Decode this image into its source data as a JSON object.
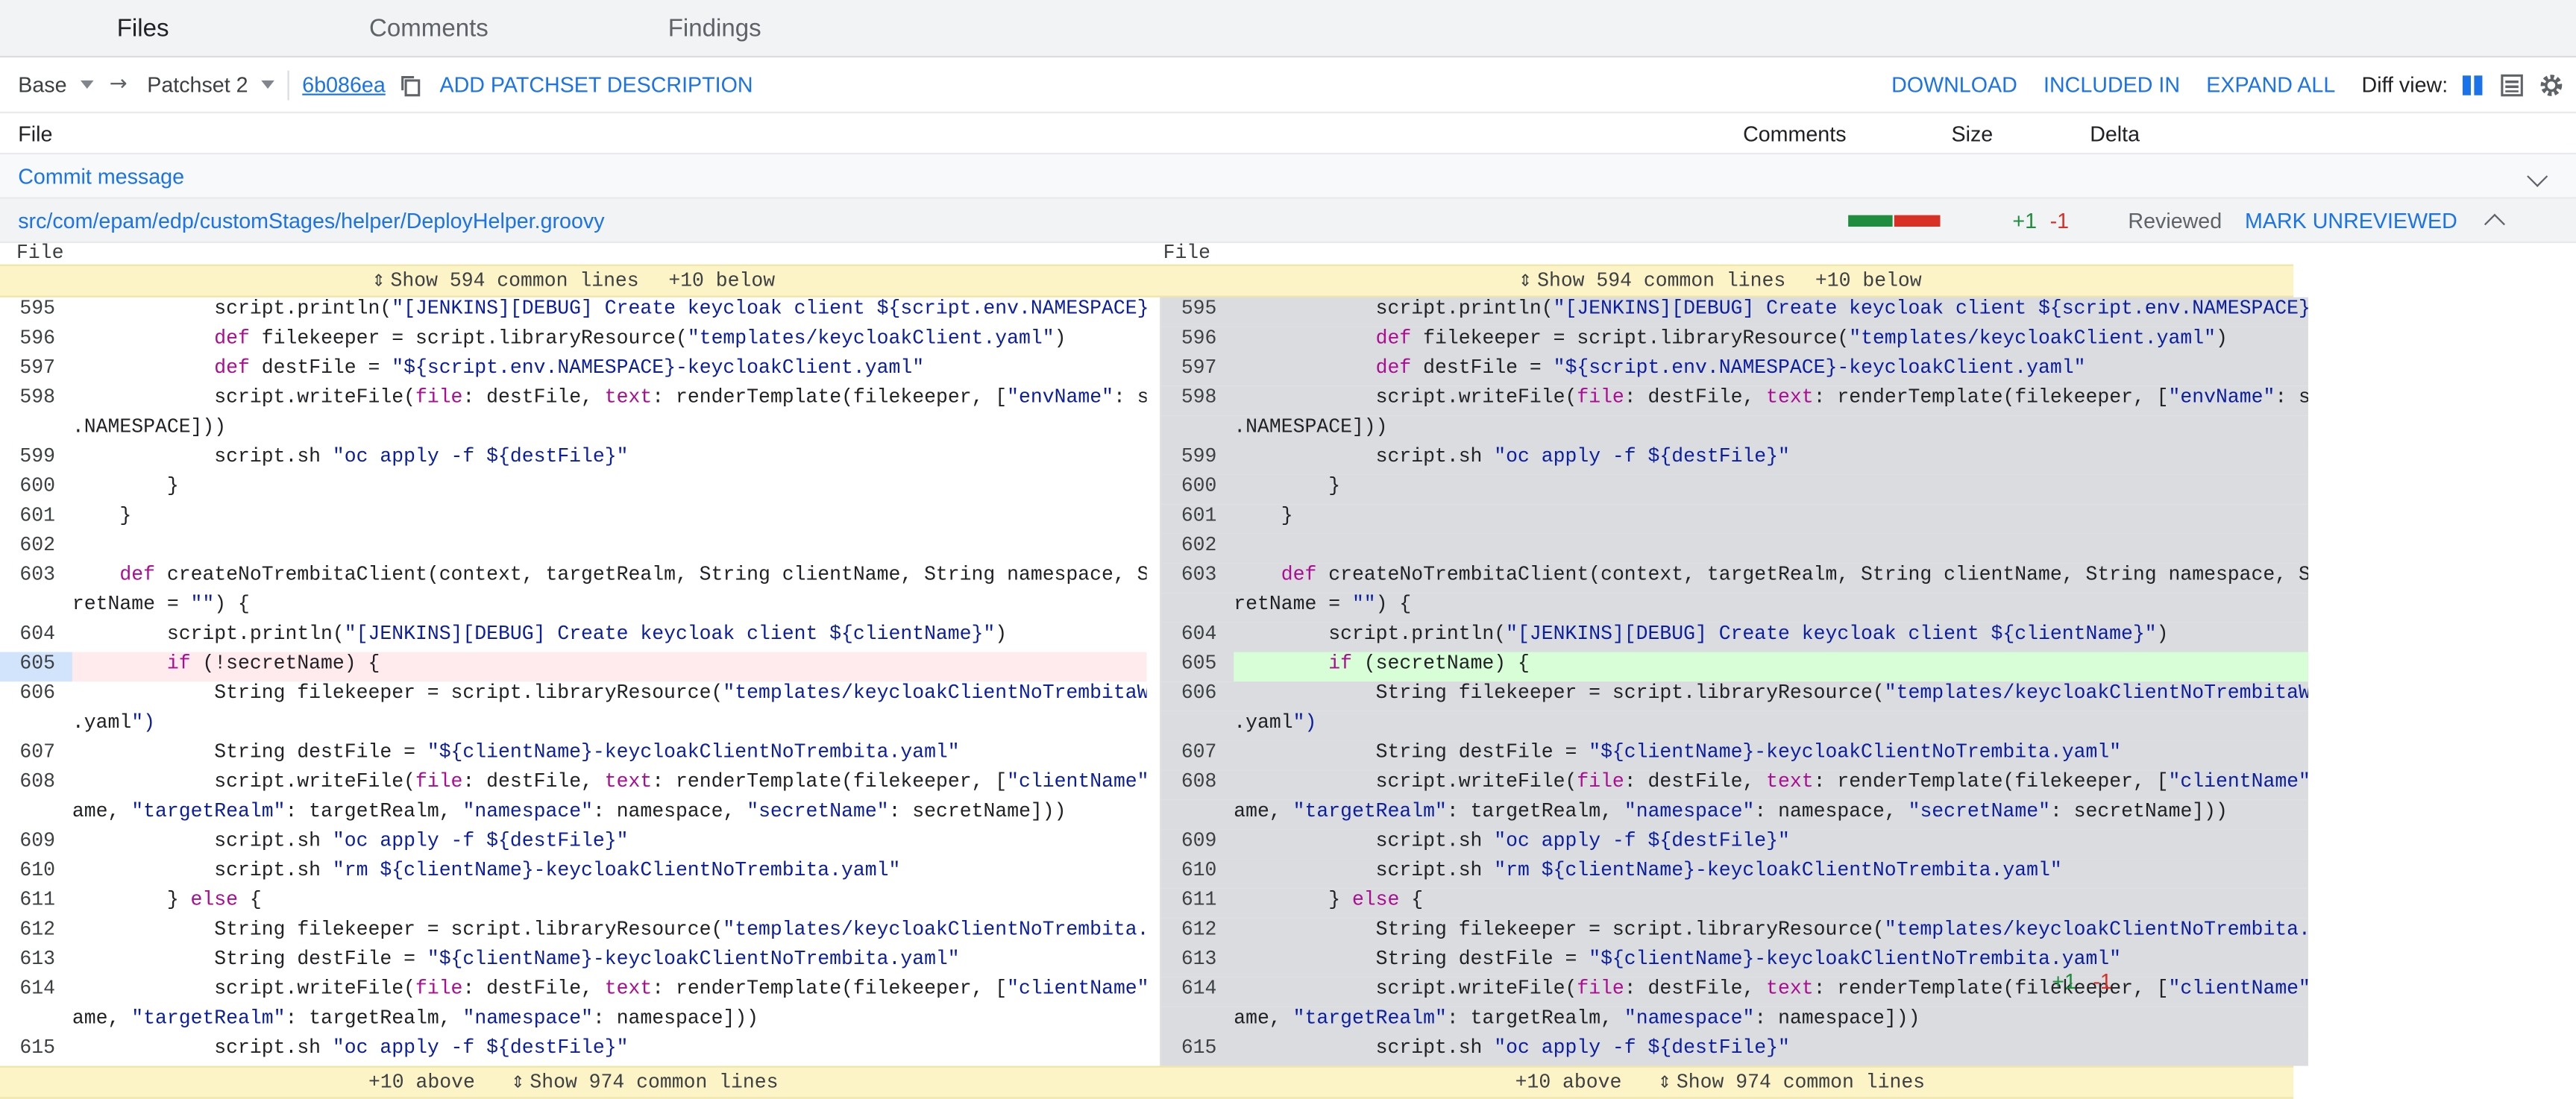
{
  "tabs": [
    {
      "label": "Files"
    },
    {
      "label": "Comments"
    },
    {
      "label": "Findings"
    }
  ],
  "toolbar": {
    "base": "Base",
    "patchset": "Patchset 2",
    "commit": "6b086ea",
    "add_description": "ADD PATCHSET DESCRIPTION",
    "download": "DOWNLOAD",
    "included_in": "INCLUDED IN",
    "expand_all": "EXPAND ALL",
    "diff_view_label": "Diff view:"
  },
  "header": {
    "file": "File",
    "comments": "Comments",
    "size": "Size",
    "delta": "Delta"
  },
  "commit_message": "Commit message",
  "file": {
    "path": "src/com/epam/edp/customStages/helper/DeployHelper.groovy",
    "added": "+1",
    "removed": "-1",
    "reviewed": "Reviewed",
    "mark_unreviewed": "MARK UNREVIEWED",
    "size_ratio": 0.5
  },
  "diff": {
    "left_header": "File",
    "right_header": "File",
    "context_top": {
      "show": "Show 594 common lines",
      "below": "+10 below"
    },
    "context_bottom": {
      "above": "+10 above",
      "show": "Show 974 common lines"
    },
    "lines": [
      {
        "left_num": "595",
        "right_num": "595",
        "left": "            script.println(\"[JENKINS][DEBUG] Create keycloak client ${script.env.NAMESPACE}-admin\")",
        "right": "            script.println(\"[JENKINS][DEBUG] Create keycloak client ${script.env.NAMESPACE}-admin\")"
      },
      {
        "left_num": "596",
        "right_num": "596",
        "left": "            def filekeeper = script.libraryResource(\"templates/keycloakClient.yaml\")",
        "right": "            def filekeeper = script.libraryResource(\"templates/keycloakClient.yaml\")"
      },
      {
        "left_num": "597",
        "right_num": "597",
        "left": "            def destFile = \"${script.env.NAMESPACE}-keycloakClient.yaml\"",
        "right": "            def destFile = \"${script.env.NAMESPACE}-keycloakClient.yaml\""
      },
      {
        "left_num": "598",
        "right_num": "598",
        "left": "            script.writeFile(file: destFile, text: renderTemplate(filekeeper, [\"envName\": script.env",
        "right": "            script.writeFile(file: destFile, text: renderTemplate(filekeeper, [\"envName\": script.env"
      },
      {
        "left_num": "",
        "right_num": "",
        "left": ".NAMESPACE]))",
        "right": ".NAMESPACE]))"
      },
      {
        "left_num": "599",
        "right_num": "599",
        "left": "            script.sh \"oc apply -f ${destFile}\"",
        "right": "            script.sh \"oc apply -f ${destFile}\""
      },
      {
        "left_num": "600",
        "right_num": "600",
        "left": "        }",
        "right": "        }"
      },
      {
        "left_num": "601",
        "right_num": "601",
        "left": "    }",
        "right": "    }"
      },
      {
        "left_num": "602",
        "right_num": "602",
        "left": "",
        "right": ""
      },
      {
        "left_num": "603",
        "right_num": "603",
        "left": "    def createNoTrembitaClient(context, targetRealm, String clientName, String namespace, String sec",
        "right": "    def createNoTrembitaClient(context, targetRealm, String clientName, String namespace, String sec"
      },
      {
        "left_num": "",
        "right_num": "",
        "left": "retName = \"\") {",
        "right": "retName = \"\") {"
      },
      {
        "left_num": "604",
        "right_num": "604",
        "left": "        script.println(\"[JENKINS][DEBUG] Create keycloak client ${clientName}\")",
        "right": "        script.println(\"[JENKINS][DEBUG] Create keycloak client ${clientName}\")"
      },
      {
        "left_num": "605",
        "right_num": "605",
        "left": "        if (!secretName) {",
        "right": "        if (secretName) {",
        "changed": true
      },
      {
        "left_num": "606",
        "right_num": "606",
        "left": "            String filekeeper = script.libraryResource(\"templates/keycloakClientNoTrembitaWithSecret",
        "right": "            String filekeeper = script.libraryResource(\"templates/keycloakClientNoTrembitaWithSecret"
      },
      {
        "left_num": "",
        "right_num": "",
        "left": ".yaml\")",
        "right": ".yaml\")"
      },
      {
        "left_num": "607",
        "right_num": "607",
        "left": "            String destFile = \"${clientName}-keycloakClientNoTrembita.yaml\"",
        "right": "            String destFile = \"${clientName}-keycloakClientNoTrembita.yaml\""
      },
      {
        "left_num": "608",
        "right_num": "608",
        "left": "            script.writeFile(file: destFile, text: renderTemplate(filekeeper, [\"clientName\": clientN",
        "right": "            script.writeFile(file: destFile, text: renderTemplate(filekeeper, [\"clientName\": clientN"
      },
      {
        "left_num": "",
        "right_num": "",
        "left": "ame, \"targetRealm\": targetRealm, \"namespace\": namespace, \"secretName\": secretName]))",
        "right": "ame, \"targetRealm\": targetRealm, \"namespace\": namespace, \"secretName\": secretName]))"
      },
      {
        "left_num": "609",
        "right_num": "609",
        "left": "            script.sh \"oc apply -f ${destFile}\"",
        "right": "            script.sh \"oc apply -f ${destFile}\""
      },
      {
        "left_num": "610",
        "right_num": "610",
        "left": "            script.sh \"rm ${clientName}-keycloakClientNoTrembita.yaml\"",
        "right": "            script.sh \"rm ${clientName}-keycloakClientNoTrembita.yaml\""
      },
      {
        "left_num": "611",
        "right_num": "611",
        "left": "        } else {",
        "right": "        } else {"
      },
      {
        "left_num": "612",
        "right_num": "612",
        "left": "            String filekeeper = script.libraryResource(\"templates/keycloakClientNoTrembita.yaml\")",
        "right": "            String filekeeper = script.libraryResource(\"templates/keycloakClientNoTrembita.yaml\")"
      },
      {
        "left_num": "613",
        "right_num": "613",
        "left": "            String destFile = \"${clientName}-keycloakClientNoTrembita.yaml\"",
        "right": "            String destFile = \"${clientName}-keycloakClientNoTrembita.yaml\""
      },
      {
        "left_num": "614",
        "right_num": "614",
        "left": "            script.writeFile(file: destFile, text: renderTemplate(filekeeper, [\"clientName\": clientN",
        "right": "            script.writeFile(file: destFile, text: renderTemplate(filekeeper, [\"clientName\": clientN"
      },
      {
        "left_num": "",
        "right_num": "",
        "left": "ame, \"targetRealm\": targetRealm, \"namespace\": namespace]))",
        "right": "ame, \"targetRealm\": targetRealm, \"namespace\": namespace]))"
      },
      {
        "left_num": "615",
        "right_num": "615",
        "left": "            script.sh \"oc apply -f ${destFile}\"",
        "right": "            script.sh \"oc apply -f ${destFile}\""
      }
    ]
  },
  "footer": {
    "added": "+1",
    "removed": "-1"
  },
  "colors": {
    "accent": "#1a73e8",
    "added": "#1e8e3e",
    "removed": "#d93025",
    "context_bg": "#fcf3c7",
    "add_bg": "#d8fed8",
    "del_bg": "#ffebee"
  },
  "icons": [
    "copy-icon",
    "arrow-right-icon",
    "side-by-side-icon",
    "unified-icon",
    "gear-icon",
    "chevron-down-icon",
    "chevron-up-icon"
  ]
}
